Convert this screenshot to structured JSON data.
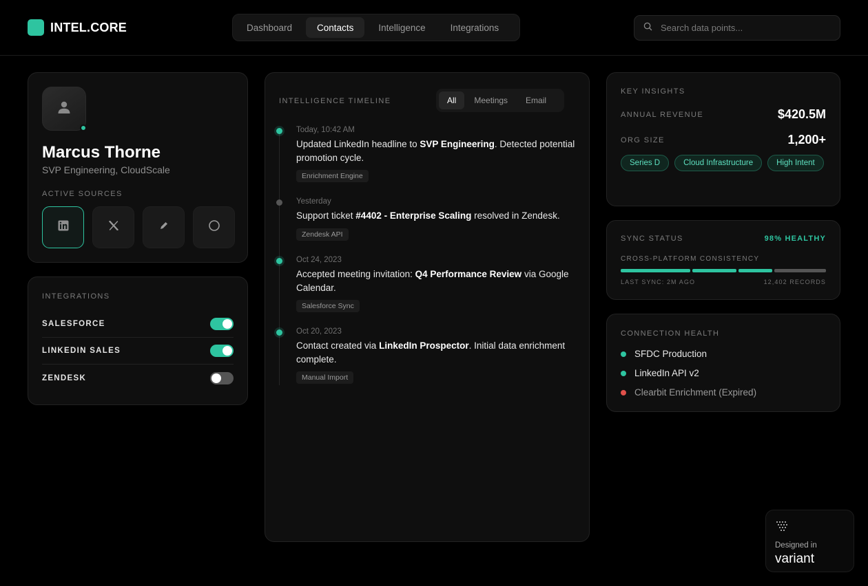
{
  "app": {
    "logo_text": "INTEL.CORE",
    "accent": "#2ec4a0"
  },
  "nav": {
    "tabs": [
      "Dashboard",
      "Contacts",
      "Intelligence",
      "Integrations"
    ],
    "active": "Contacts"
  },
  "search": {
    "placeholder": "Search data points..."
  },
  "profile": {
    "name": "Marcus Thorne",
    "title": "SVP Engineering, CloudScale",
    "status": "online",
    "sources_label": "ACTIVE SOURCES",
    "sources": [
      {
        "icon": "linkedin-icon",
        "active": true
      },
      {
        "icon": "x-icon",
        "active": false
      },
      {
        "icon": "pen-icon",
        "active": false
      },
      {
        "icon": "circle-icon",
        "active": false
      }
    ]
  },
  "integrations": {
    "label": "INTEGRATIONS",
    "items": [
      {
        "name": "SALESFORCE",
        "enabled": true
      },
      {
        "name": "LINKEDIN SALES",
        "enabled": true
      },
      {
        "name": "ZENDESK",
        "enabled": false
      }
    ]
  },
  "timeline": {
    "label": "INTELLIGENCE TIMELINE",
    "filters": [
      "All",
      "Meetings",
      "Email"
    ],
    "active_filter": "All",
    "events": [
      {
        "date": "Today, 10:42 AM",
        "pre": "Updated LinkedIn headline to ",
        "bold": "SVP Engineering",
        "post": ". Detected potential promotion cycle.",
        "tag": "Enrichment Engine",
        "dot": "#2ec4a0"
      },
      {
        "date": "Yesterday",
        "pre": "Support ticket ",
        "bold": "#4402 - Enterprise Scaling",
        "post": " resolved in Zendesk.",
        "tag": "Zendesk API",
        "dot": "#555555"
      },
      {
        "date": "Oct 24, 2023",
        "pre": "Accepted meeting invitation: ",
        "bold": "Q4 Performance Review",
        "post": " via Google Calendar.",
        "tag": "Salesforce Sync",
        "dot": "#2ec4a0"
      },
      {
        "date": "Oct 20, 2023",
        "pre": "Contact created via ",
        "bold": "LinkedIn Prospector",
        "post": ". Initial data enrichment complete.",
        "tag": "Manual Import",
        "dot": "#2ec4a0"
      }
    ]
  },
  "insights": {
    "label": "KEY INSIGHTS",
    "revenue_label": "ANNUAL REVENUE",
    "revenue_value": "$420.5M",
    "org_label": "ORG SIZE",
    "org_value": "1,200+",
    "tags": [
      "Series D",
      "Cloud Infrastructure",
      "High Intent"
    ]
  },
  "sync": {
    "label": "SYNC STATUS",
    "health": "98% HEALTHY",
    "consistency_label": "CROSS-PLATFORM CONSISTENCY",
    "segments": [
      {
        "fraction": 0.35,
        "color": "#2ec4a0"
      },
      {
        "fraction": 0.22,
        "color": "#2ec4a0"
      },
      {
        "fraction": 0.17,
        "color": "#2ec4a0"
      },
      {
        "fraction": 0.26,
        "color": "#555555"
      }
    ],
    "last_sync": "LAST SYNC: 2M AGO",
    "records": "12,402 RECORDS"
  },
  "connections": {
    "label": "CONNECTION HEALTH",
    "items": [
      {
        "name": "SFDC Production",
        "color": "#2ec4a0",
        "muted": false
      },
      {
        "name": "LinkedIn API v2",
        "color": "#2ec4a0",
        "muted": false
      },
      {
        "name": "Clearbit Enrichment (Expired)",
        "color": "#e0504a",
        "muted": true
      }
    ]
  },
  "badge": {
    "line1": "Designed in",
    "line2": "variant"
  }
}
